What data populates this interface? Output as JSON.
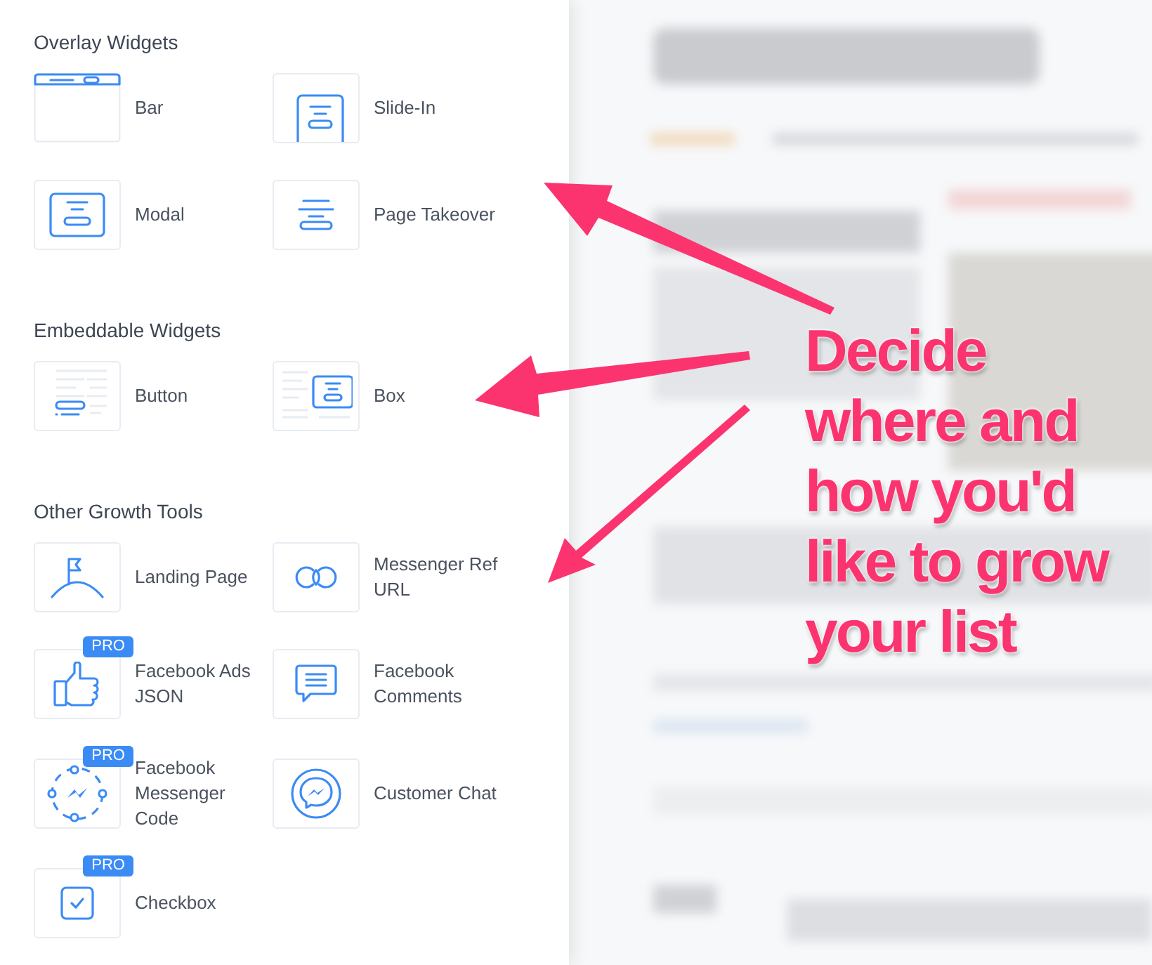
{
  "sections": [
    {
      "title": "Overlay Widgets",
      "items": [
        {
          "label": "Bar",
          "kind": "bar",
          "pro": false
        },
        {
          "label": "Slide-In",
          "kind": "slide_in",
          "pro": false
        },
        {
          "label": "Modal",
          "kind": "modal",
          "pro": false
        },
        {
          "label": "Page Takeover",
          "kind": "takeover",
          "pro": false
        }
      ]
    },
    {
      "title": "Embeddable Widgets",
      "items": [
        {
          "label": "Button",
          "kind": "button",
          "pro": false
        },
        {
          "label": "Box",
          "kind": "box",
          "pro": false
        }
      ]
    },
    {
      "title": "Other Growth Tools",
      "items": [
        {
          "label": "Landing Page",
          "kind": "flag",
          "pro": false
        },
        {
          "label": "Messenger Ref URL",
          "kind": "link",
          "pro": false
        },
        {
          "label": "Facebook Ads JSON",
          "kind": "thumb",
          "pro": true,
          "badge": "PRO"
        },
        {
          "label": "Facebook Comments",
          "kind": "comment",
          "pro": false
        },
        {
          "label": "Facebook Messenger Code",
          "kind": "code",
          "pro": true,
          "badge": "PRO"
        },
        {
          "label": "Customer Chat",
          "kind": "chat",
          "pro": false
        },
        {
          "label": "Checkbox",
          "kind": "checkbox",
          "pro": true,
          "badge": "PRO"
        }
      ]
    }
  ],
  "annotation": {
    "text": "Decide where and how you'd like to grow your list"
  }
}
